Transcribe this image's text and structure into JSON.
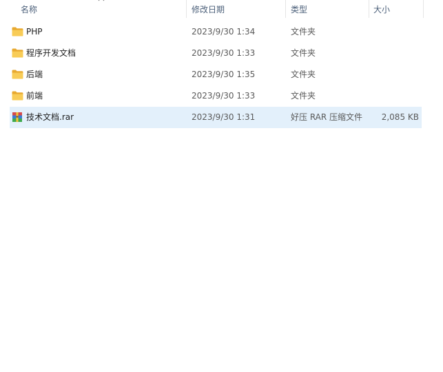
{
  "columns": {
    "name": "名称",
    "date_modified": "修改日期",
    "type": "类型",
    "size": "大小",
    "sort_icon": "chevron-up-icon"
  },
  "files": [
    {
      "name": "PHP",
      "date": "2023/9/30 1:34",
      "type": "文件夹",
      "size": "",
      "icon": "folder-icon",
      "selected": false
    },
    {
      "name": "程序开发文档",
      "date": "2023/9/30 1:33",
      "type": "文件夹",
      "size": "",
      "icon": "folder-icon",
      "selected": false
    },
    {
      "name": "后端",
      "date": "2023/9/30 1:35",
      "type": "文件夹",
      "size": "",
      "icon": "folder-icon",
      "selected": false
    },
    {
      "name": "前端",
      "date": "2023/9/30 1:33",
      "type": "文件夹",
      "size": "",
      "icon": "folder-icon",
      "selected": false
    },
    {
      "name": "技术文档.rar",
      "date": "2023/9/30 1:31",
      "type": "好压 RAR 压缩文件",
      "size": "2,085 KB",
      "icon": "rar-archive-icon",
      "selected": true
    }
  ],
  "colors": {
    "selection": "#e3f0fb",
    "folder": "#f5c24c",
    "header_text": "#4c607a"
  }
}
